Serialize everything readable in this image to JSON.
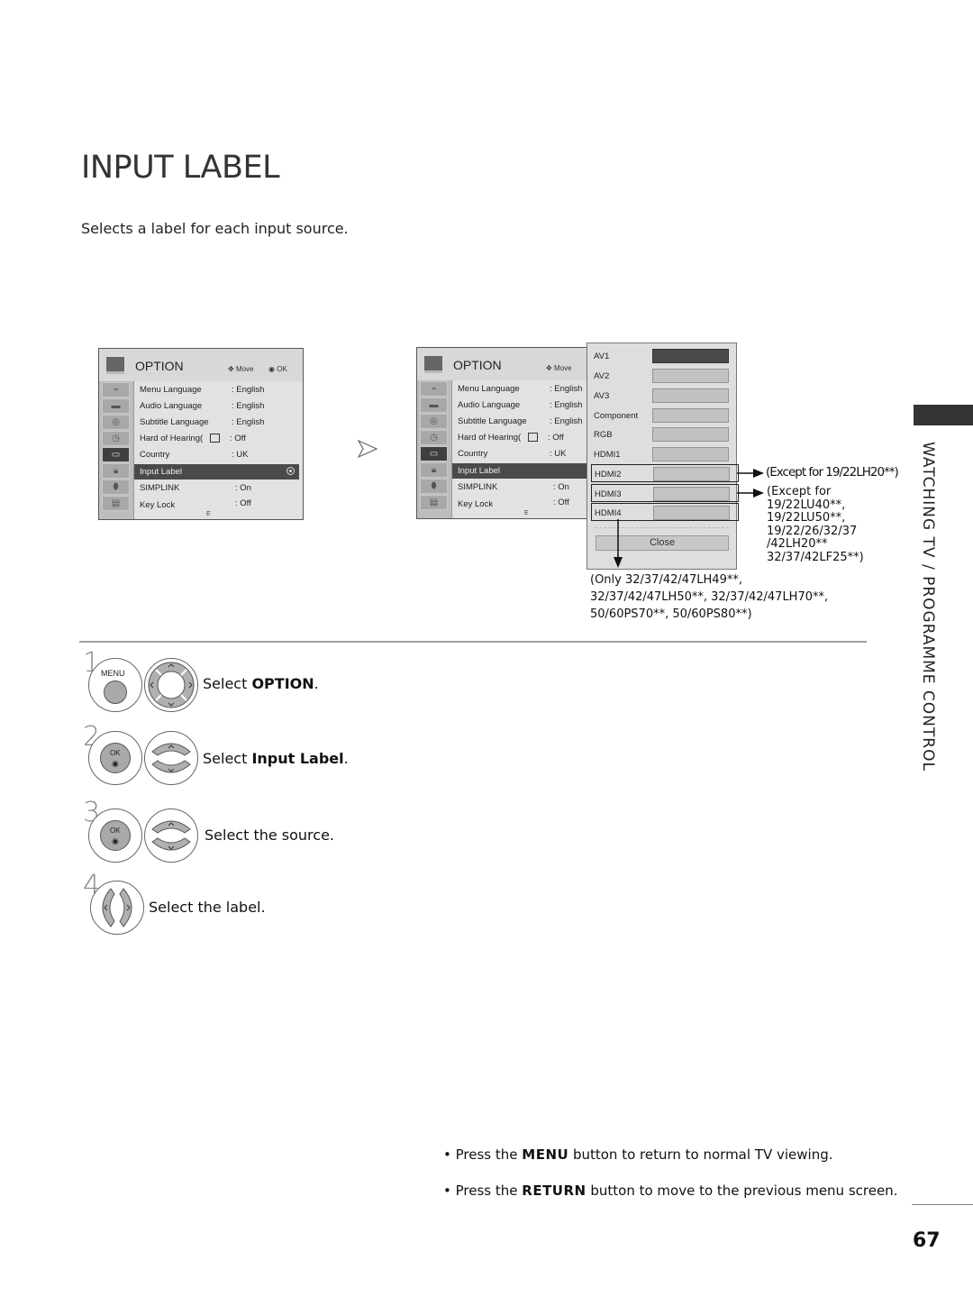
{
  "page": {
    "title": "INPUT LABEL",
    "description": "Selects a label for each input source.",
    "section_tab": "WATCHING TV / PROGRAMME CONTROL",
    "page_number": "67"
  },
  "osd_menus": [
    {
      "title": "OPTION",
      "hint_move": "Move",
      "hint_ok": "OK",
      "footer_char": "E",
      "side_icons": [
        "satellite-dish-icon",
        "monitor-icon",
        "speaker-icon",
        "clock-icon",
        "tv-option-icon",
        "lock-icon",
        "usb-icon",
        "clapper-icon"
      ],
      "active_icon_index": 4,
      "rows": [
        {
          "label": "Menu Language",
          "value": ": English"
        },
        {
          "label": "Audio Language",
          "value": ": English"
        },
        {
          "label": "Subtitle Language",
          "value": ": English"
        },
        {
          "label": "Hard of Hearing(",
          "value": ": Off"
        },
        {
          "label": "Country",
          "value": ": UK"
        },
        {
          "label": "Input Label",
          "value": ""
        },
        {
          "label": "SIMPLINK",
          "value": ": On"
        },
        {
          "label": "Key Lock",
          "value": ": Off"
        }
      ],
      "selected_row_index": 5
    },
    {
      "title": "OPTION",
      "hint_move": "Move",
      "footer_char": "E",
      "rows": [
        {
          "label": "Menu Language",
          "value": ": English"
        },
        {
          "label": "Audio Language",
          "value": ": English"
        },
        {
          "label": "Subtitle Language",
          "value": ": English"
        },
        {
          "label": "Hard of Hearing(",
          "value": ": Off"
        },
        {
          "label": "Country",
          "value": ": UK"
        },
        {
          "label": "Input Label",
          "value": ""
        },
        {
          "label": "SIMPLINK",
          "value": ": On"
        },
        {
          "label": "Key Lock",
          "value": ": Off"
        }
      ],
      "selected_row_index": 5
    }
  ],
  "input_label_popup": {
    "sources": [
      "AV1",
      "AV2",
      "AV3",
      "Component",
      "RGB",
      "HDMI1",
      "HDMI2",
      "HDMI3",
      "HDMI4"
    ],
    "active_source_index": 0,
    "close_label": "Close"
  },
  "notes": {
    "hdmi2": "(Except for 19/22LH20**)",
    "hdmi3": [
      "(Except for",
      "19/22LU40**,",
      "19/22LU50**,",
      "19/22/26/32/37",
      "/42LH20**",
      "32/37/42LF25**)"
    ],
    "hdmi4": [
      "(Only 32/37/42/47LH49**,",
      "32/37/42/47LH50**, 32/37/42/47LH70**,",
      "50/60PS70**, 50/60PS80**)"
    ]
  },
  "steps": [
    {
      "num": "1",
      "text_pre": "Select ",
      "text_bold": "OPTION",
      "text_post": ".",
      "button_label": "MENU"
    },
    {
      "num": "2",
      "text_pre": "Select ",
      "text_bold": "Input Label",
      "text_post": ".",
      "button_label": "OK"
    },
    {
      "num": "3",
      "text_pre": "Select the source.",
      "text_bold": "",
      "text_post": "",
      "button_label": "OK"
    },
    {
      "num": "4",
      "text_pre": "Select the label.",
      "text_bold": "",
      "text_post": ""
    }
  ],
  "tips": [
    {
      "pre": "Press the ",
      "bold": "MENU",
      "post": " button to return to normal TV viewing."
    },
    {
      "pre": "Press the ",
      "bold": "RETURN",
      "post": " button to move to the previous menu screen."
    }
  ]
}
